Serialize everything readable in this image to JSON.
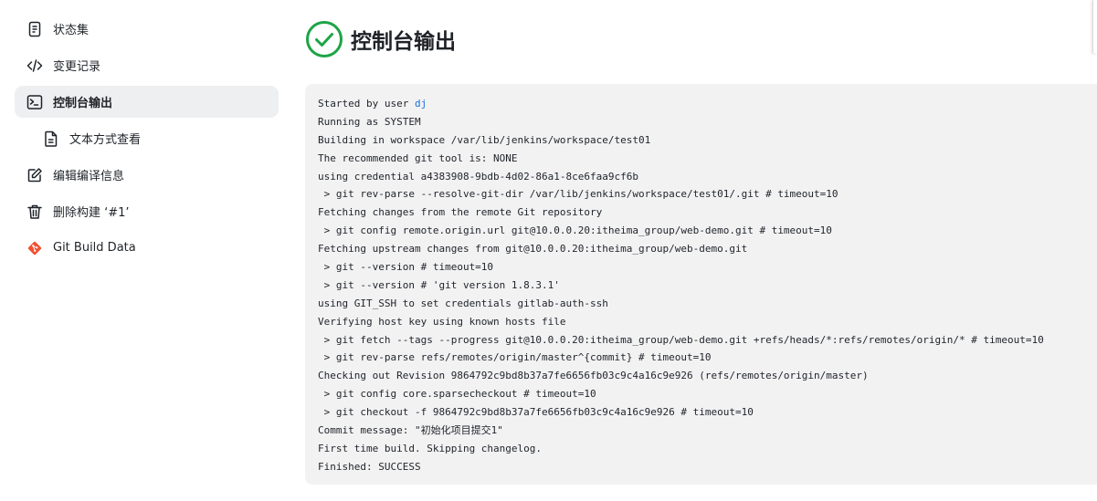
{
  "sidebar": {
    "items": [
      {
        "label": "状态集",
        "icon": "document-icon"
      },
      {
        "label": "变更记录",
        "icon": "code-icon"
      },
      {
        "label": "控制台输出",
        "icon": "terminal-icon",
        "active": true
      },
      {
        "label": "文本方式查看",
        "icon": "file-text-icon"
      },
      {
        "label": "编辑编译信息",
        "icon": "edit-icon"
      },
      {
        "label": "删除构建 ‘#1’",
        "icon": "trash-icon"
      },
      {
        "label": "Git Build Data",
        "icon": "git-icon"
      }
    ]
  },
  "header": {
    "title": "控制台输出",
    "status_icon": "success-check-icon",
    "status_color": "#1ea446"
  },
  "console": {
    "user_prefix": "Started by user ",
    "user": "dj",
    "lines": [
      "Running as SYSTEM",
      "Building in workspace /var/lib/jenkins/workspace/test01",
      "The recommended git tool is: NONE",
      "using credential a4383908-9bdb-4d02-86a1-8ce6faa9cf6b",
      " > git rev-parse --resolve-git-dir /var/lib/jenkins/workspace/test01/.git # timeout=10",
      "Fetching changes from the remote Git repository",
      " > git config remote.origin.url git@10.0.0.20:itheima_group/web-demo.git # timeout=10",
      "Fetching upstream changes from git@10.0.0.20:itheima_group/web-demo.git",
      " > git --version # timeout=10",
      " > git --version # 'git version 1.8.3.1'",
      "using GIT_SSH to set credentials gitlab-auth-ssh",
      "Verifying host key using known hosts file",
      " > git fetch --tags --progress git@10.0.0.20:itheima_group/web-demo.git +refs/heads/*:refs/remotes/origin/* # timeout=10",
      " > git rev-parse refs/remotes/origin/master^{commit} # timeout=10",
      "Checking out Revision 9864792c9bd8b37a7fe6656fb03c9c4a16c9e926 (refs/remotes/origin/master)",
      " > git config core.sparsecheckout # timeout=10",
      " > git checkout -f 9864792c9bd8b37a7fe6656fb03c9c4a16c9e926 # timeout=10",
      "Commit message: \"初始化项目提交1\"",
      "First time build. Skipping changelog.",
      "Finished: SUCCESS"
    ]
  }
}
